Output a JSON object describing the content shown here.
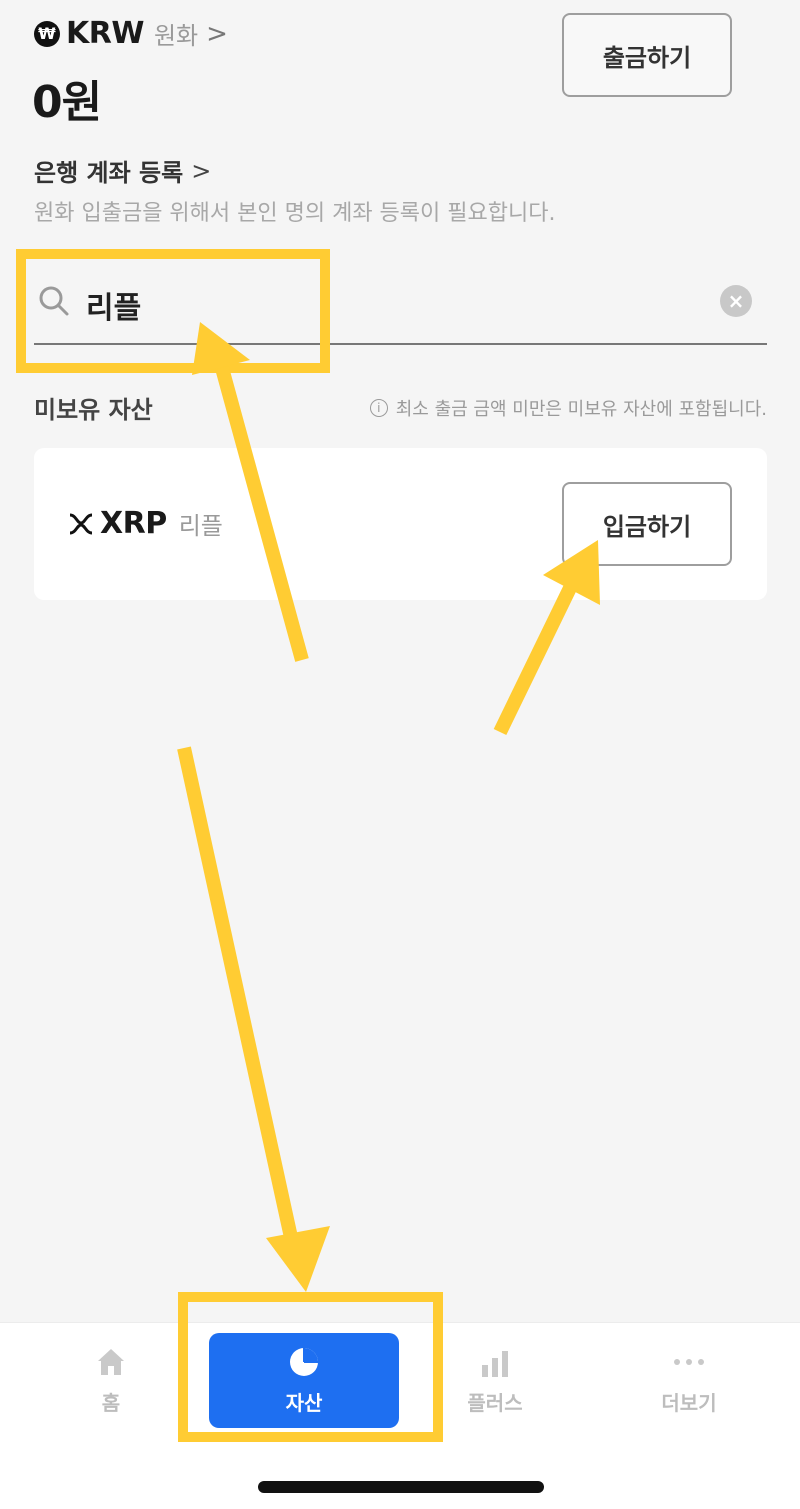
{
  "header": {
    "currency_symbol": "₩",
    "currency_code": "KRW",
    "currency_name": "원화",
    "chevron": ">",
    "balance": "0원",
    "withdraw_label": "출금하기"
  },
  "bank": {
    "link_label": "은행 계좌 등록",
    "chevron": ">",
    "hint": "원화 입출금을 위해서 본인 명의 계좌 등록이 필요합니다."
  },
  "search": {
    "value": "리플",
    "clear_symbol": "×"
  },
  "section": {
    "title": "미보유 자산",
    "info_symbol": "i",
    "note": "최소 출금 금액 미만은 미보유 자산에 포함됩니다."
  },
  "asset": {
    "symbol": "XRP",
    "name": "리플",
    "deposit_label": "입금하기"
  },
  "tabs": [
    {
      "label": "홈",
      "icon": "home-icon",
      "active": false
    },
    {
      "label": "자산",
      "icon": "pie-chart-icon",
      "active": true
    },
    {
      "label": "플러스",
      "icon": "bar-chart-icon",
      "active": false
    },
    {
      "label": "더보기",
      "icon": "more-dots-icon",
      "active": false
    }
  ],
  "colors": {
    "accent": "#1e6ff1",
    "annotation": "#ffcc33",
    "background": "#f5f5f5"
  }
}
